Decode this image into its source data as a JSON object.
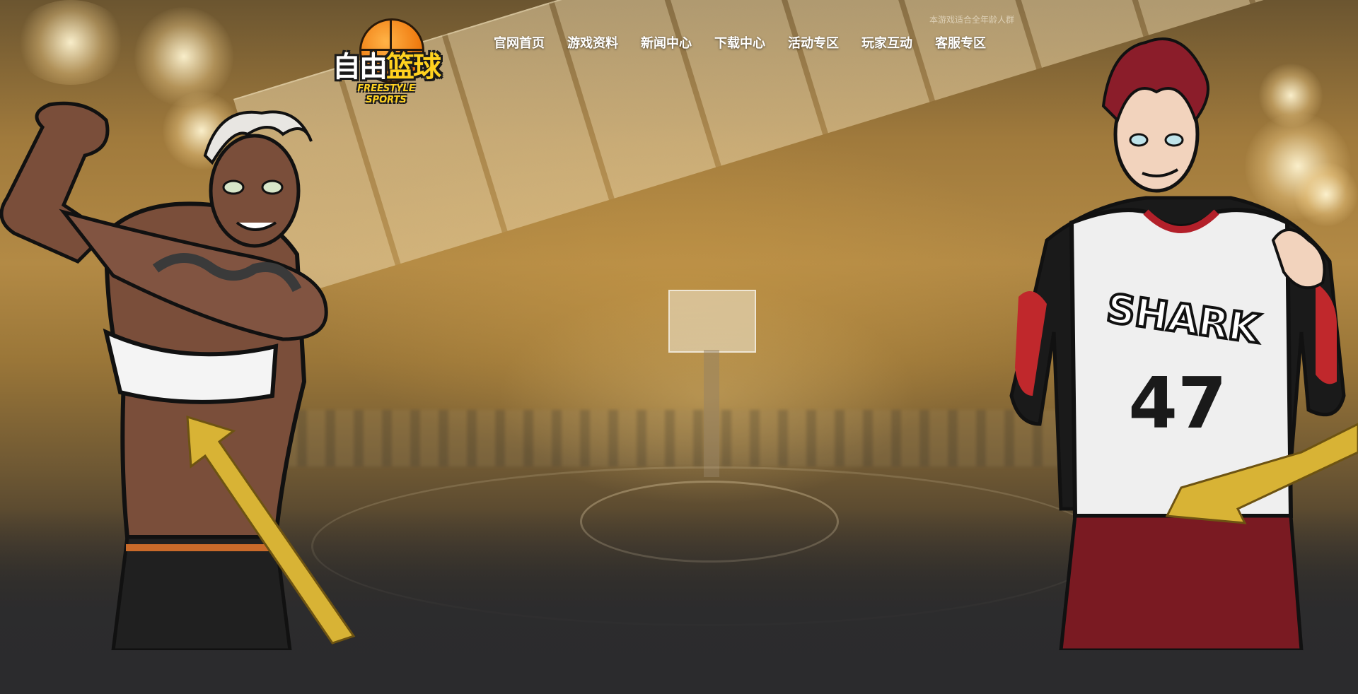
{
  "header": {
    "logo": {
      "title_part1": "自由",
      "title_part2": "篮球",
      "title_part3": "球",
      "subtitle": "FREESTYLE SPORTS"
    },
    "age_note": "本游戏适合全年龄人群",
    "nav": [
      {
        "label": "官网首页"
      },
      {
        "label": "游戏资料"
      },
      {
        "label": "新闻中心"
      },
      {
        "label": "下载中心"
      },
      {
        "label": "活动专区"
      },
      {
        "label": "玩家互动"
      },
      {
        "label": "客服专区"
      }
    ]
  },
  "hero": {
    "right_character": {
      "jersey_text": "SHARK",
      "jersey_number": "47"
    }
  },
  "colors": {
    "accent_yellow": "#ffd21f",
    "ball_orange": "#f07d12",
    "background_dark": "#2b2b2d",
    "jersey_red": "#b3202a"
  }
}
